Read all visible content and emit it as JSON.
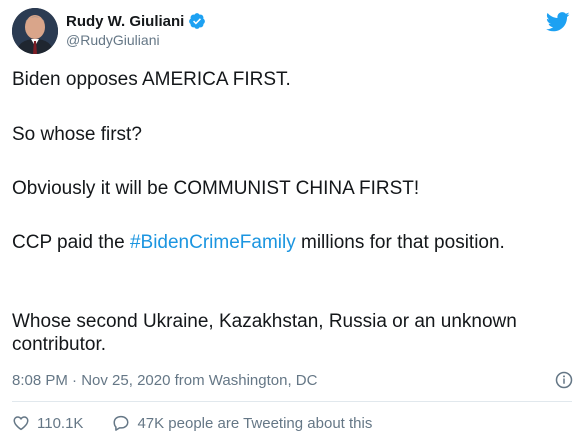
{
  "author": {
    "name": "Rudy W. Giuliani",
    "handle": "@RudyGiuliani",
    "verified": true
  },
  "tweet": {
    "line1": "Biden opposes AMERICA FIRST.",
    "line2": "So whose first?",
    "line3": "Obviously it will be COMMUNIST CHINA FIRST!",
    "line4_prefix": "CCP paid the ",
    "line4_hashtag": "#BidenCrimeFamily",
    "line4_suffix": " millions for that position.",
    "line5": "Whose second Ukraine, Kazakhstan, Russia or an unknown contributor."
  },
  "meta": {
    "time": "8:08 PM",
    "separator": "·",
    "date": "Nov 25, 2020",
    "source": "from Washington, DC"
  },
  "actions": {
    "likes": "110.1K",
    "conversation": "47K people are Tweeting about this"
  },
  "colors": {
    "accent": "#1b95e0",
    "twitter_blue": "#1da1f2",
    "muted": "#657786"
  },
  "icons": [
    "verified-badge-icon",
    "twitter-bird-icon",
    "info-icon",
    "heart-icon",
    "speech-bubble-icon"
  ]
}
